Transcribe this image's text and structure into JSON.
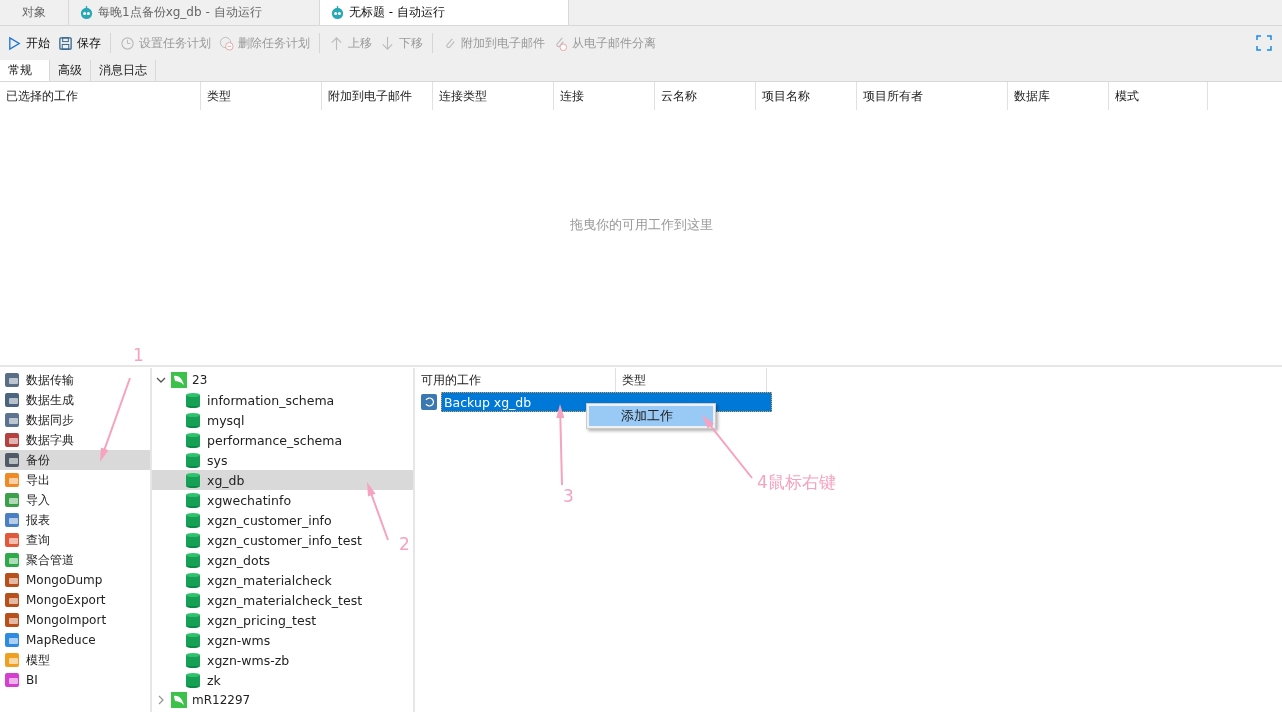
{
  "tabs": [
    {
      "label": "对象",
      "selected": false,
      "icon": false
    },
    {
      "label": "每晚1点备份xg_db - 自动运行",
      "selected": false,
      "icon": true
    },
    {
      "label": "无标题 - 自动运行",
      "selected": true,
      "icon": true
    }
  ],
  "toolbar": [
    {
      "label": "开始",
      "disabled": false,
      "kind": "play"
    },
    {
      "label": "保存",
      "disabled": false,
      "kind": "save"
    },
    {
      "label": "设置任务计划",
      "disabled": true,
      "kind": "clock"
    },
    {
      "label": "删除任务计划",
      "disabled": true,
      "kind": "remove"
    },
    {
      "label": "上移",
      "disabled": true,
      "kind": "up"
    },
    {
      "label": "下移",
      "disabled": true,
      "kind": "down"
    },
    {
      "label": "附加到电子邮件",
      "disabled": true,
      "kind": "clip"
    },
    {
      "label": "从电子邮件分离",
      "disabled": true,
      "kind": "unclip"
    }
  ],
  "sub_tabs": [
    {
      "label": "常规",
      "selected": true
    },
    {
      "label": "高级",
      "selected": false
    },
    {
      "label": "消息日志",
      "selected": false
    }
  ],
  "selected_jobs": {
    "columns": [
      "已选择的工作",
      "类型",
      "附加到电子邮件",
      "连接类型",
      "连接",
      "云名称",
      "项目名称",
      "项目所有者",
      "数据库",
      "模式"
    ],
    "empty_hint": "拖曳你的可用工作到这里"
  },
  "categories": [
    {
      "label": "数据传输",
      "selected": false
    },
    {
      "label": "数据生成",
      "selected": false
    },
    {
      "label": "数据同步",
      "selected": false
    },
    {
      "label": "数据字典",
      "selected": false
    },
    {
      "label": "备份",
      "selected": true
    },
    {
      "label": "导出",
      "selected": false
    },
    {
      "label": "导入",
      "selected": false
    },
    {
      "label": "报表",
      "selected": false
    },
    {
      "label": "查询",
      "selected": false
    },
    {
      "label": "聚合管道",
      "selected": false
    },
    {
      "label": "MongoDump",
      "selected": false
    },
    {
      "label": "MongoExport",
      "selected": false
    },
    {
      "label": "MongoImport",
      "selected": false
    },
    {
      "label": "MapReduce",
      "selected": false
    },
    {
      "label": "模型",
      "selected": false
    },
    {
      "label": "BI",
      "selected": false
    }
  ],
  "tree": [
    {
      "label": "23",
      "expanded": true,
      "selected": false,
      "children": [
        {
          "label": "information_schema",
          "selected": false
        },
        {
          "label": "mysql",
          "selected": false
        },
        {
          "label": "performance_schema",
          "selected": false
        },
        {
          "label": "sys",
          "selected": false
        },
        {
          "label": "xg_db",
          "selected": true
        },
        {
          "label": "xgwechatinfo",
          "selected": false
        },
        {
          "label": "xgzn_customer_info",
          "selected": false
        },
        {
          "label": "xgzn_customer_info_test",
          "selected": false
        },
        {
          "label": "xgzn_dots",
          "selected": false
        },
        {
          "label": "xgzn_materialcheck",
          "selected": false
        },
        {
          "label": "xgzn_materialcheck_test",
          "selected": false
        },
        {
          "label": "xgzn_pricing_test",
          "selected": false
        },
        {
          "label": "xgzn-wms",
          "selected": false
        },
        {
          "label": "xgzn-wms-zb",
          "selected": false
        },
        {
          "label": "zk",
          "selected": false
        }
      ]
    },
    {
      "label": "mR12297",
      "expanded": false,
      "selected": false
    }
  ],
  "available_jobs": {
    "columns": [
      "可用的工作",
      "类型"
    ],
    "rows": [
      {
        "name": "Backup xg_db",
        "selected": true
      }
    ]
  },
  "context_menu": {
    "items": [
      {
        "label": "添加工作",
        "selected": true
      }
    ]
  },
  "annotations": [
    "1",
    "2",
    "3",
    "4鼠标右键"
  ]
}
